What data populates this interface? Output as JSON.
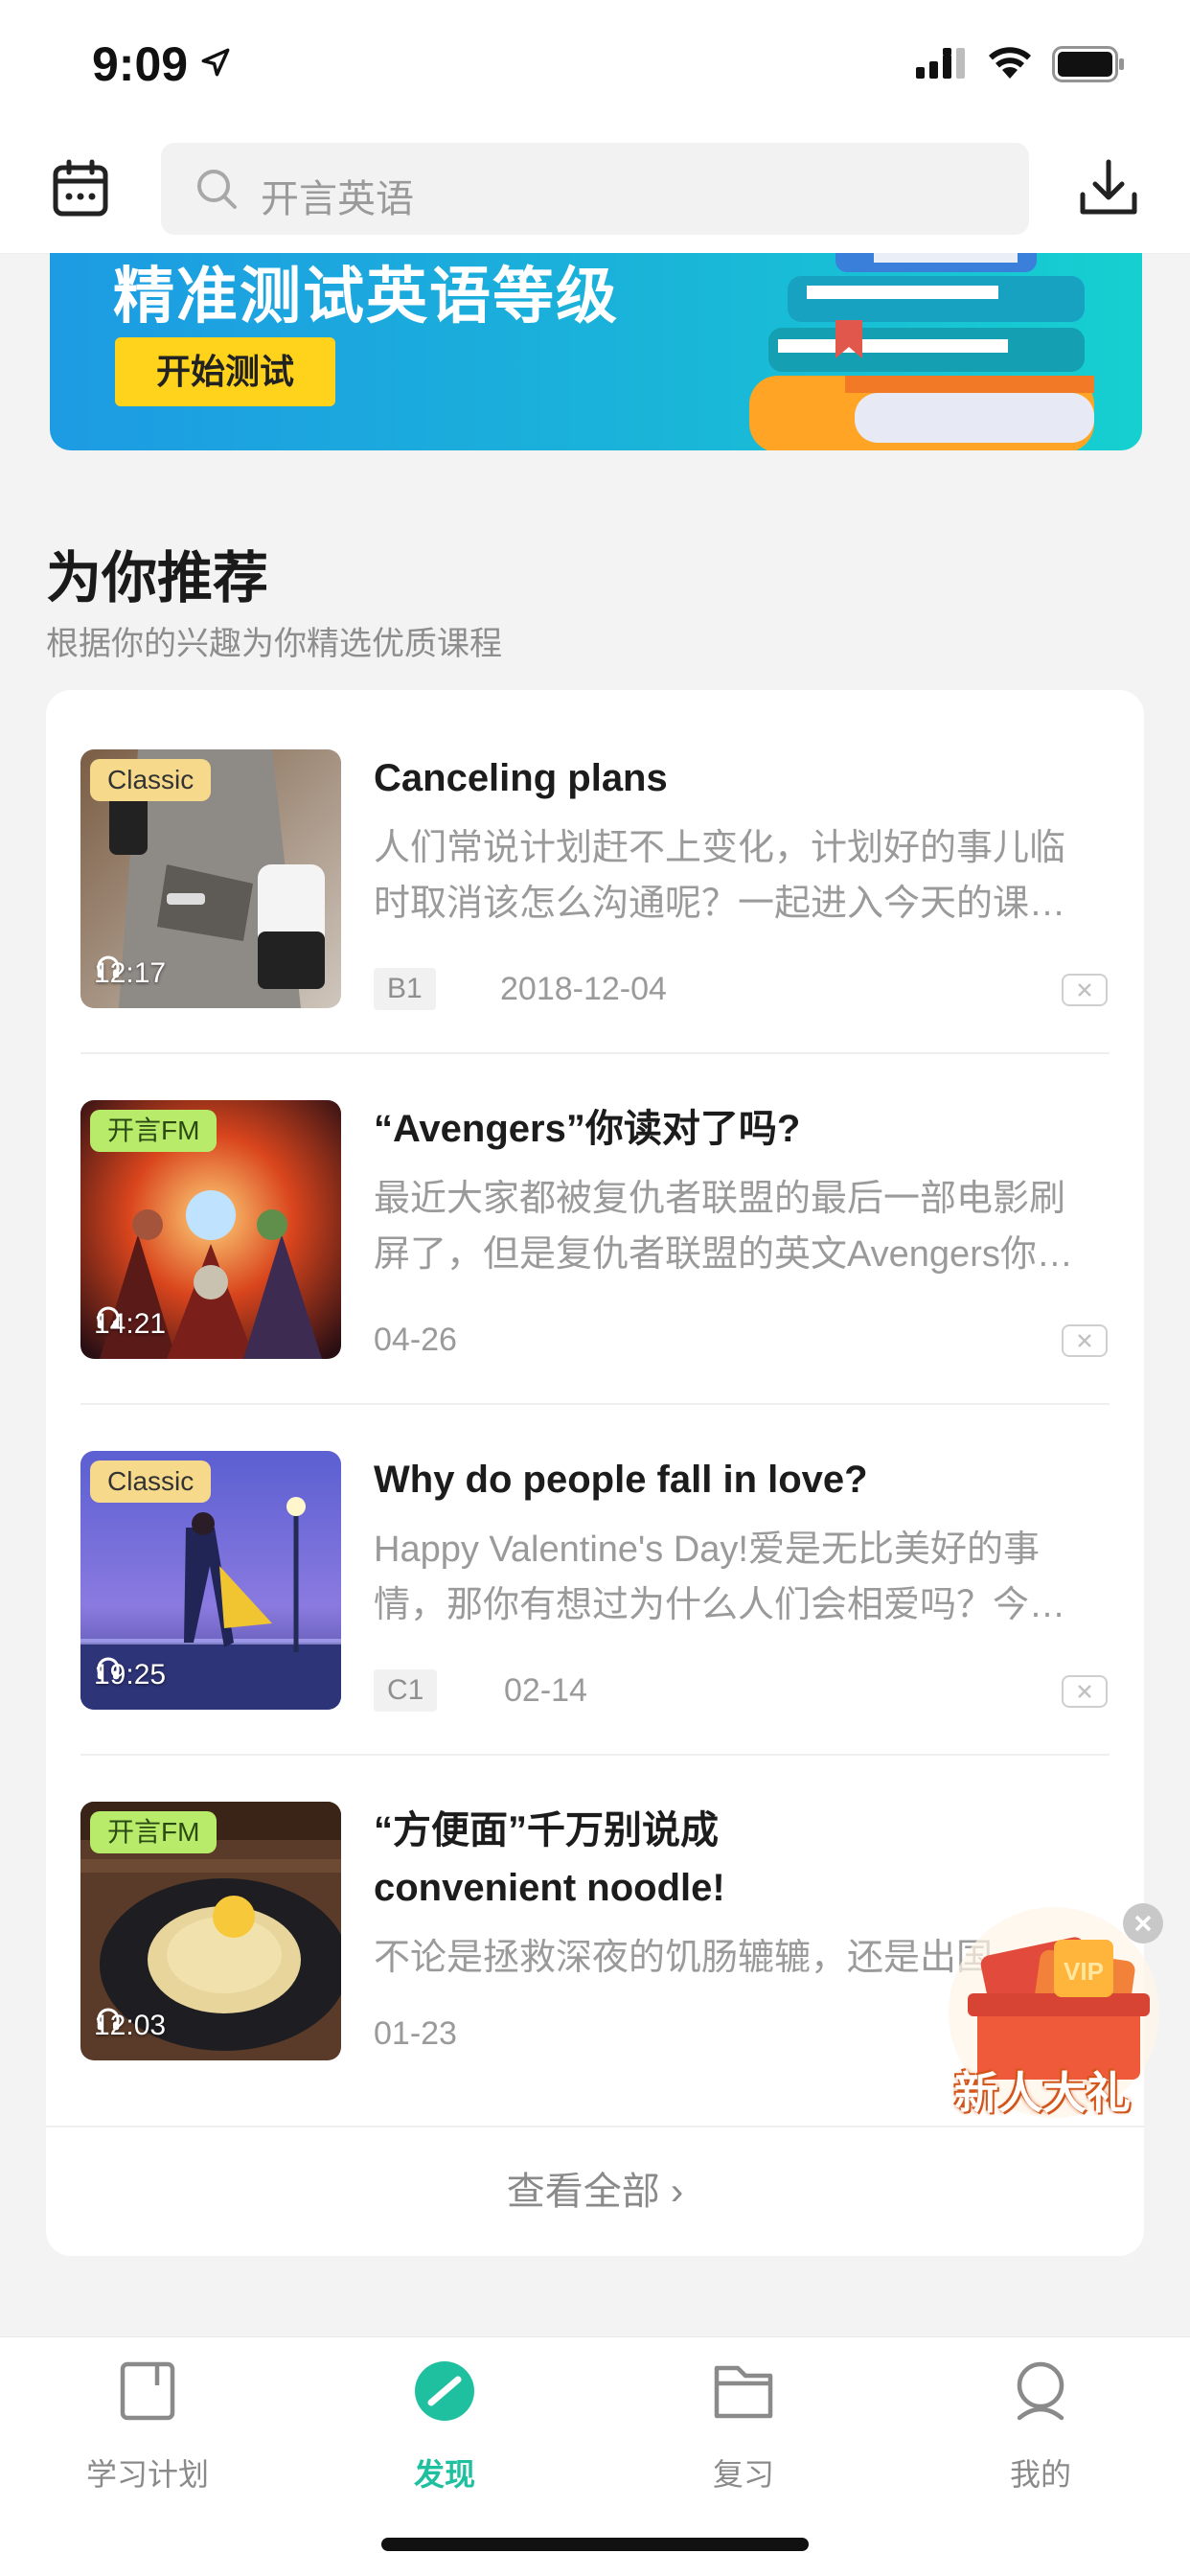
{
  "status": {
    "time": "9:09"
  },
  "header": {
    "search_placeholder": "开言英语"
  },
  "banner": {
    "title": "精准测试英语等级",
    "button": "开始测试"
  },
  "section": {
    "title": "为你推荐",
    "subtitle": "根据你的兴趣为你精选优质课程"
  },
  "items": [
    {
      "tag": "Classic",
      "duration": "12:17",
      "title": "Canceling plans",
      "desc_line1": "人们常说计划赶不上变化，计划好的事儿临",
      "desc_line2": "时取消该怎么沟通呢？一起进入今天的课…",
      "level": "B1",
      "date": "2018-12-04"
    },
    {
      "tag": "开言FM",
      "duration": "14:21",
      "title": "“Avengers”你读对了吗?",
      "desc_line1": "最近大家都被复仇者联盟的最后一部电影刷",
      "desc_line2": "屏了，但是复仇者联盟的英文Avengers你…",
      "level": "",
      "date": "04-26"
    },
    {
      "tag": "Classic",
      "duration": "19:25",
      "title": "Why do people fall in love?",
      "desc_line1": "Happy Valentine's Day!爱是无比美好的事",
      "desc_line2": "情，那你有想过为什么人们会相爱吗？今…",
      "level": "C1",
      "date": "02-14"
    },
    {
      "tag": "开言FM",
      "duration": "12:03",
      "title_line1": "“方便面”千万别说成",
      "title_line2": "convenient noodle!",
      "desc_line1": "不论是拯救深夜的饥肠辘辘，还是出国",
      "level": "",
      "date": "01-23"
    }
  ],
  "view_all": "查看全部 ›",
  "promo": {
    "badge": "VIP",
    "label": "新人大礼"
  },
  "tabs": [
    {
      "label": "学习计划",
      "active": false
    },
    {
      "label": "发现",
      "active": true
    },
    {
      "label": "复习",
      "active": false
    },
    {
      "label": "我的",
      "active": false
    }
  ],
  "colors": {
    "accent": "#1fc0a0",
    "banner_button": "#ffd21b",
    "banner": "#1d9be3"
  }
}
